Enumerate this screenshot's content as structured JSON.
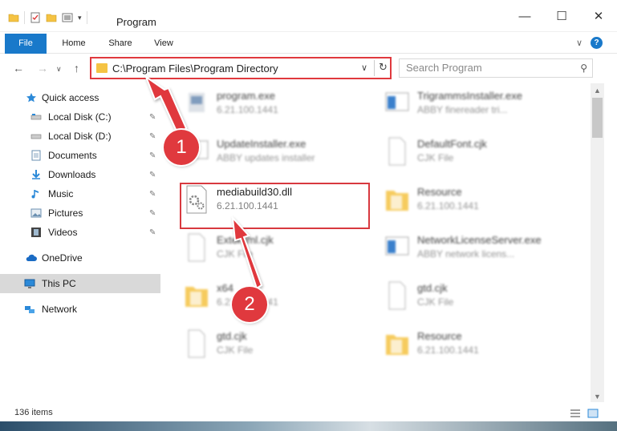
{
  "window": {
    "title": "Program",
    "minimize": "—",
    "maximize": "☐",
    "close": "✕"
  },
  "ribbon": {
    "tabs": [
      "File",
      "Home",
      "Share",
      "View"
    ],
    "collapse": "∨",
    "help": "?"
  },
  "nav": {
    "back": "←",
    "forward": "→",
    "recent": "∨",
    "up": "↑",
    "address": "C:\\Program Files\\Program Directory",
    "address_dropdown": "∨",
    "refresh": "↻",
    "search_placeholder": "Search Program",
    "search_icon": "⚲"
  },
  "sidebar": {
    "items": [
      {
        "label": "Quick access",
        "icon": "star-icon"
      },
      {
        "label": "Local Disk (C:)",
        "icon": "drive-icon",
        "pinned": true
      },
      {
        "label": "Local Disk (D:)",
        "icon": "drive-icon",
        "pinned": true
      },
      {
        "label": "Documents",
        "icon": "documents-icon",
        "pinned": true
      },
      {
        "label": "Downloads",
        "icon": "downloads-icon",
        "pinned": true
      },
      {
        "label": "Music",
        "icon": "music-icon",
        "pinned": true
      },
      {
        "label": "Pictures",
        "icon": "pictures-icon",
        "pinned": true
      },
      {
        "label": "Videos",
        "icon": "videos-icon",
        "pinned": true
      },
      {
        "label": "OneDrive",
        "icon": "cloud-icon"
      },
      {
        "label": "This PC",
        "icon": "computer-icon",
        "selected": true
      },
      {
        "label": "Network",
        "icon": "network-icon"
      }
    ],
    "pin_glyph": "📌"
  },
  "files": [
    {
      "name": "program.exe",
      "desc": "6.21.100.1441"
    },
    {
      "name": "TrigrammsInstaller.exe",
      "desc": "ABBY finereader tri..."
    },
    {
      "name": "UpdateInstaller.exe",
      "desc": "ABBY updates installer"
    },
    {
      "name": "DefaultFont.cjk",
      "desc": "CJK File"
    },
    {
      "name": "mediabuild30.dll",
      "desc": "6.21.100.1441"
    },
    {
      "name": "Resource",
      "desc": "6.21.100.1441"
    },
    {
      "name": "Externml.cjk",
      "desc": "CJK File"
    },
    {
      "name": "NetworkLicenseServer.exe",
      "desc": "ABBY network licens..."
    },
    {
      "name": "x64",
      "desc": "6.21.100.1441"
    },
    {
      "name": "gtd.cjk",
      "desc": "CJK File"
    },
    {
      "name": "gtd.cjk",
      "desc": "CJK File"
    },
    {
      "name": "Resource",
      "desc": "6.21.100.1441"
    }
  ],
  "status": {
    "item_count": "136 items"
  },
  "annotations": {
    "step1": "1",
    "step2": "2"
  },
  "colors": {
    "accent": "#1979ca",
    "highlight": "#e0393e",
    "folder": "#f5c343"
  }
}
